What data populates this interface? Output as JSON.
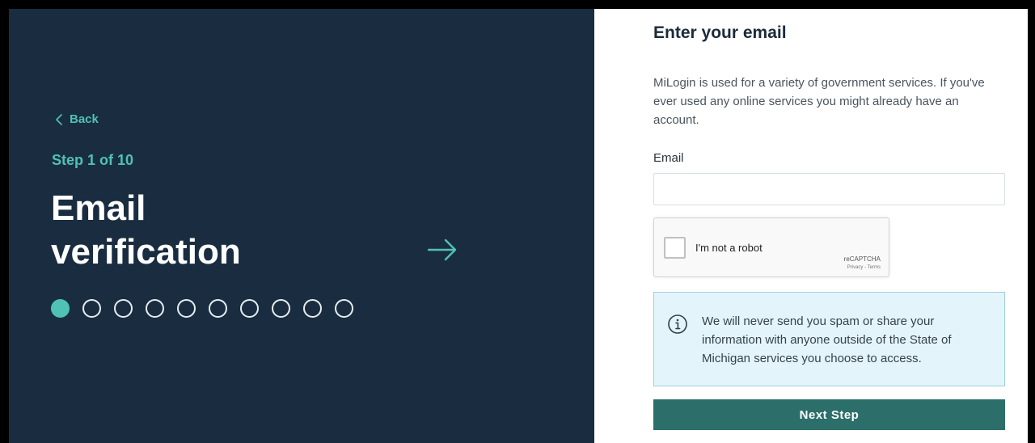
{
  "left": {
    "back_label": "Back",
    "step_label": "Step 1 of 10",
    "title_line1": "Email",
    "title_line2": "verification",
    "progress": {
      "current": 1,
      "total": 10
    },
    "icons": {
      "back": "chevron-left-icon",
      "next": "arrow-right-icon"
    }
  },
  "form": {
    "title": "Enter your email",
    "intro": "MiLogin is used for a variety of government services. If you've ever used any online services you might already have an account.",
    "email_label": "Email",
    "email_value": "",
    "email_placeholder": ""
  },
  "captcha": {
    "label": "I'm not a robot",
    "brand": "reCAPTCHA",
    "links": "Privacy - Terms",
    "checked": false
  },
  "notice": {
    "icon": "info-icon",
    "text": "We will never send you spam or share your information with anyone outside of the State of Michigan services you choose to access."
  },
  "buttons": {
    "next_label": "Next Step"
  },
  "colors": {
    "panel_bg": "#1a2d40",
    "accent": "#4fc1b5",
    "button_bg": "#2c6f6a",
    "notice_bg": "#e3f5fa",
    "notice_border": "#9fcfde"
  }
}
